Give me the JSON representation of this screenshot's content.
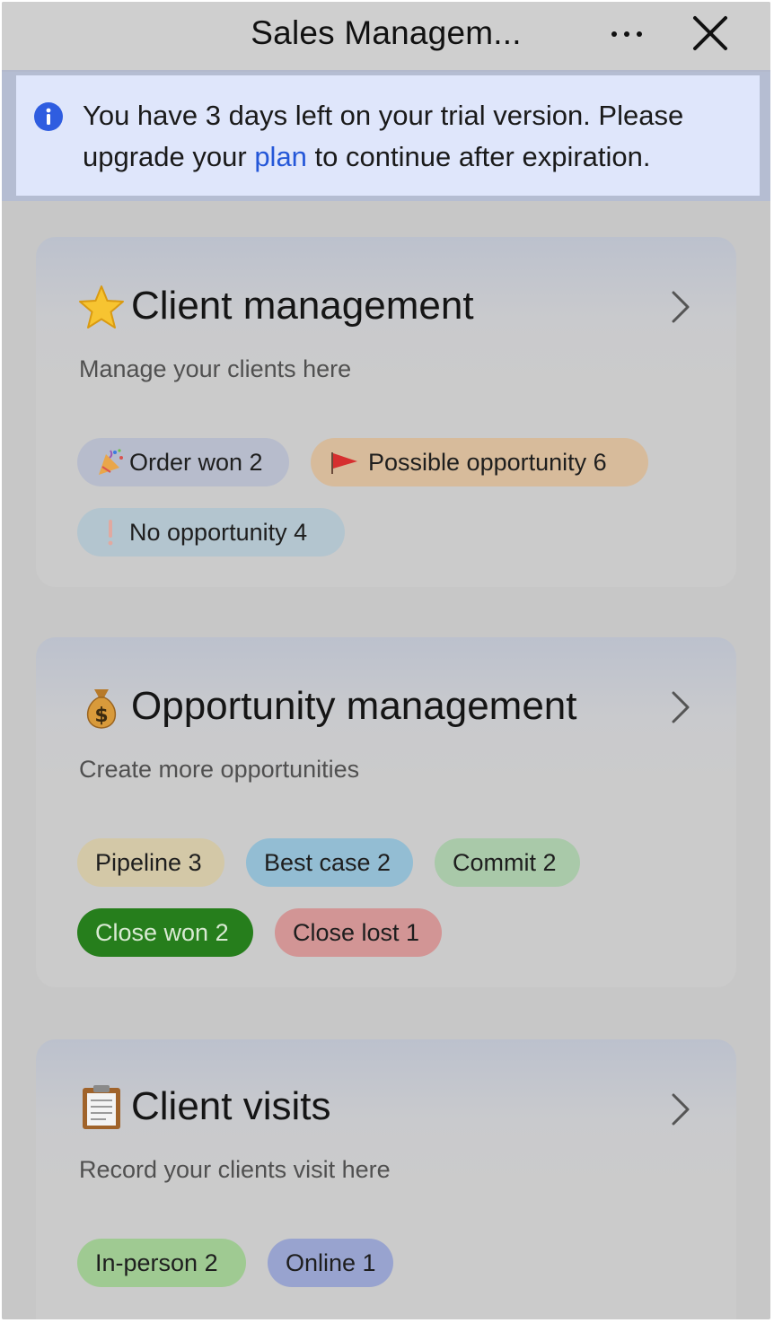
{
  "header": {
    "title": "Sales Managem..."
  },
  "banner": {
    "text_before": "You have 3 days left on your trial version. Please upgrade your ",
    "link": "plan",
    "text_after": " to continue after expiration."
  },
  "cards": [
    {
      "title": "Client management",
      "subtitle": "Manage your clients here",
      "icon": "star-emoji",
      "tags": [
        {
          "label": "Order won 2",
          "icon": "party-popper-icon",
          "color": "#b7bccc"
        },
        {
          "label": "Possible opportunity 6",
          "icon": "red-flag-icon",
          "color": "#d7bb9b"
        },
        {
          "label": "No opportunity 4",
          "icon": "exclamation-icon",
          "color": "#b3c5cf"
        }
      ]
    },
    {
      "title": "Opportunity management",
      "subtitle": "Create more opportunities",
      "icon": "money-bag-emoji",
      "tags": [
        {
          "label": "Pipeline 3",
          "color": "#d3c8a7"
        },
        {
          "label": "Best case 2",
          "color": "#93bdd3"
        },
        {
          "label": "Commit 2",
          "color": "#a9c9a9"
        },
        {
          "label": "Close won 2",
          "color": "#267e1c"
        },
        {
          "label": "Close lost 1",
          "color": "#d29595"
        }
      ]
    },
    {
      "title": "Client visits",
      "subtitle": "Record your clients visit here",
      "icon": "clipboard-emoji",
      "tags": [
        {
          "label": "In-person 2",
          "color": "#9fca92"
        },
        {
          "label": "Online 1",
          "color": "#98a3cf"
        }
      ]
    }
  ]
}
